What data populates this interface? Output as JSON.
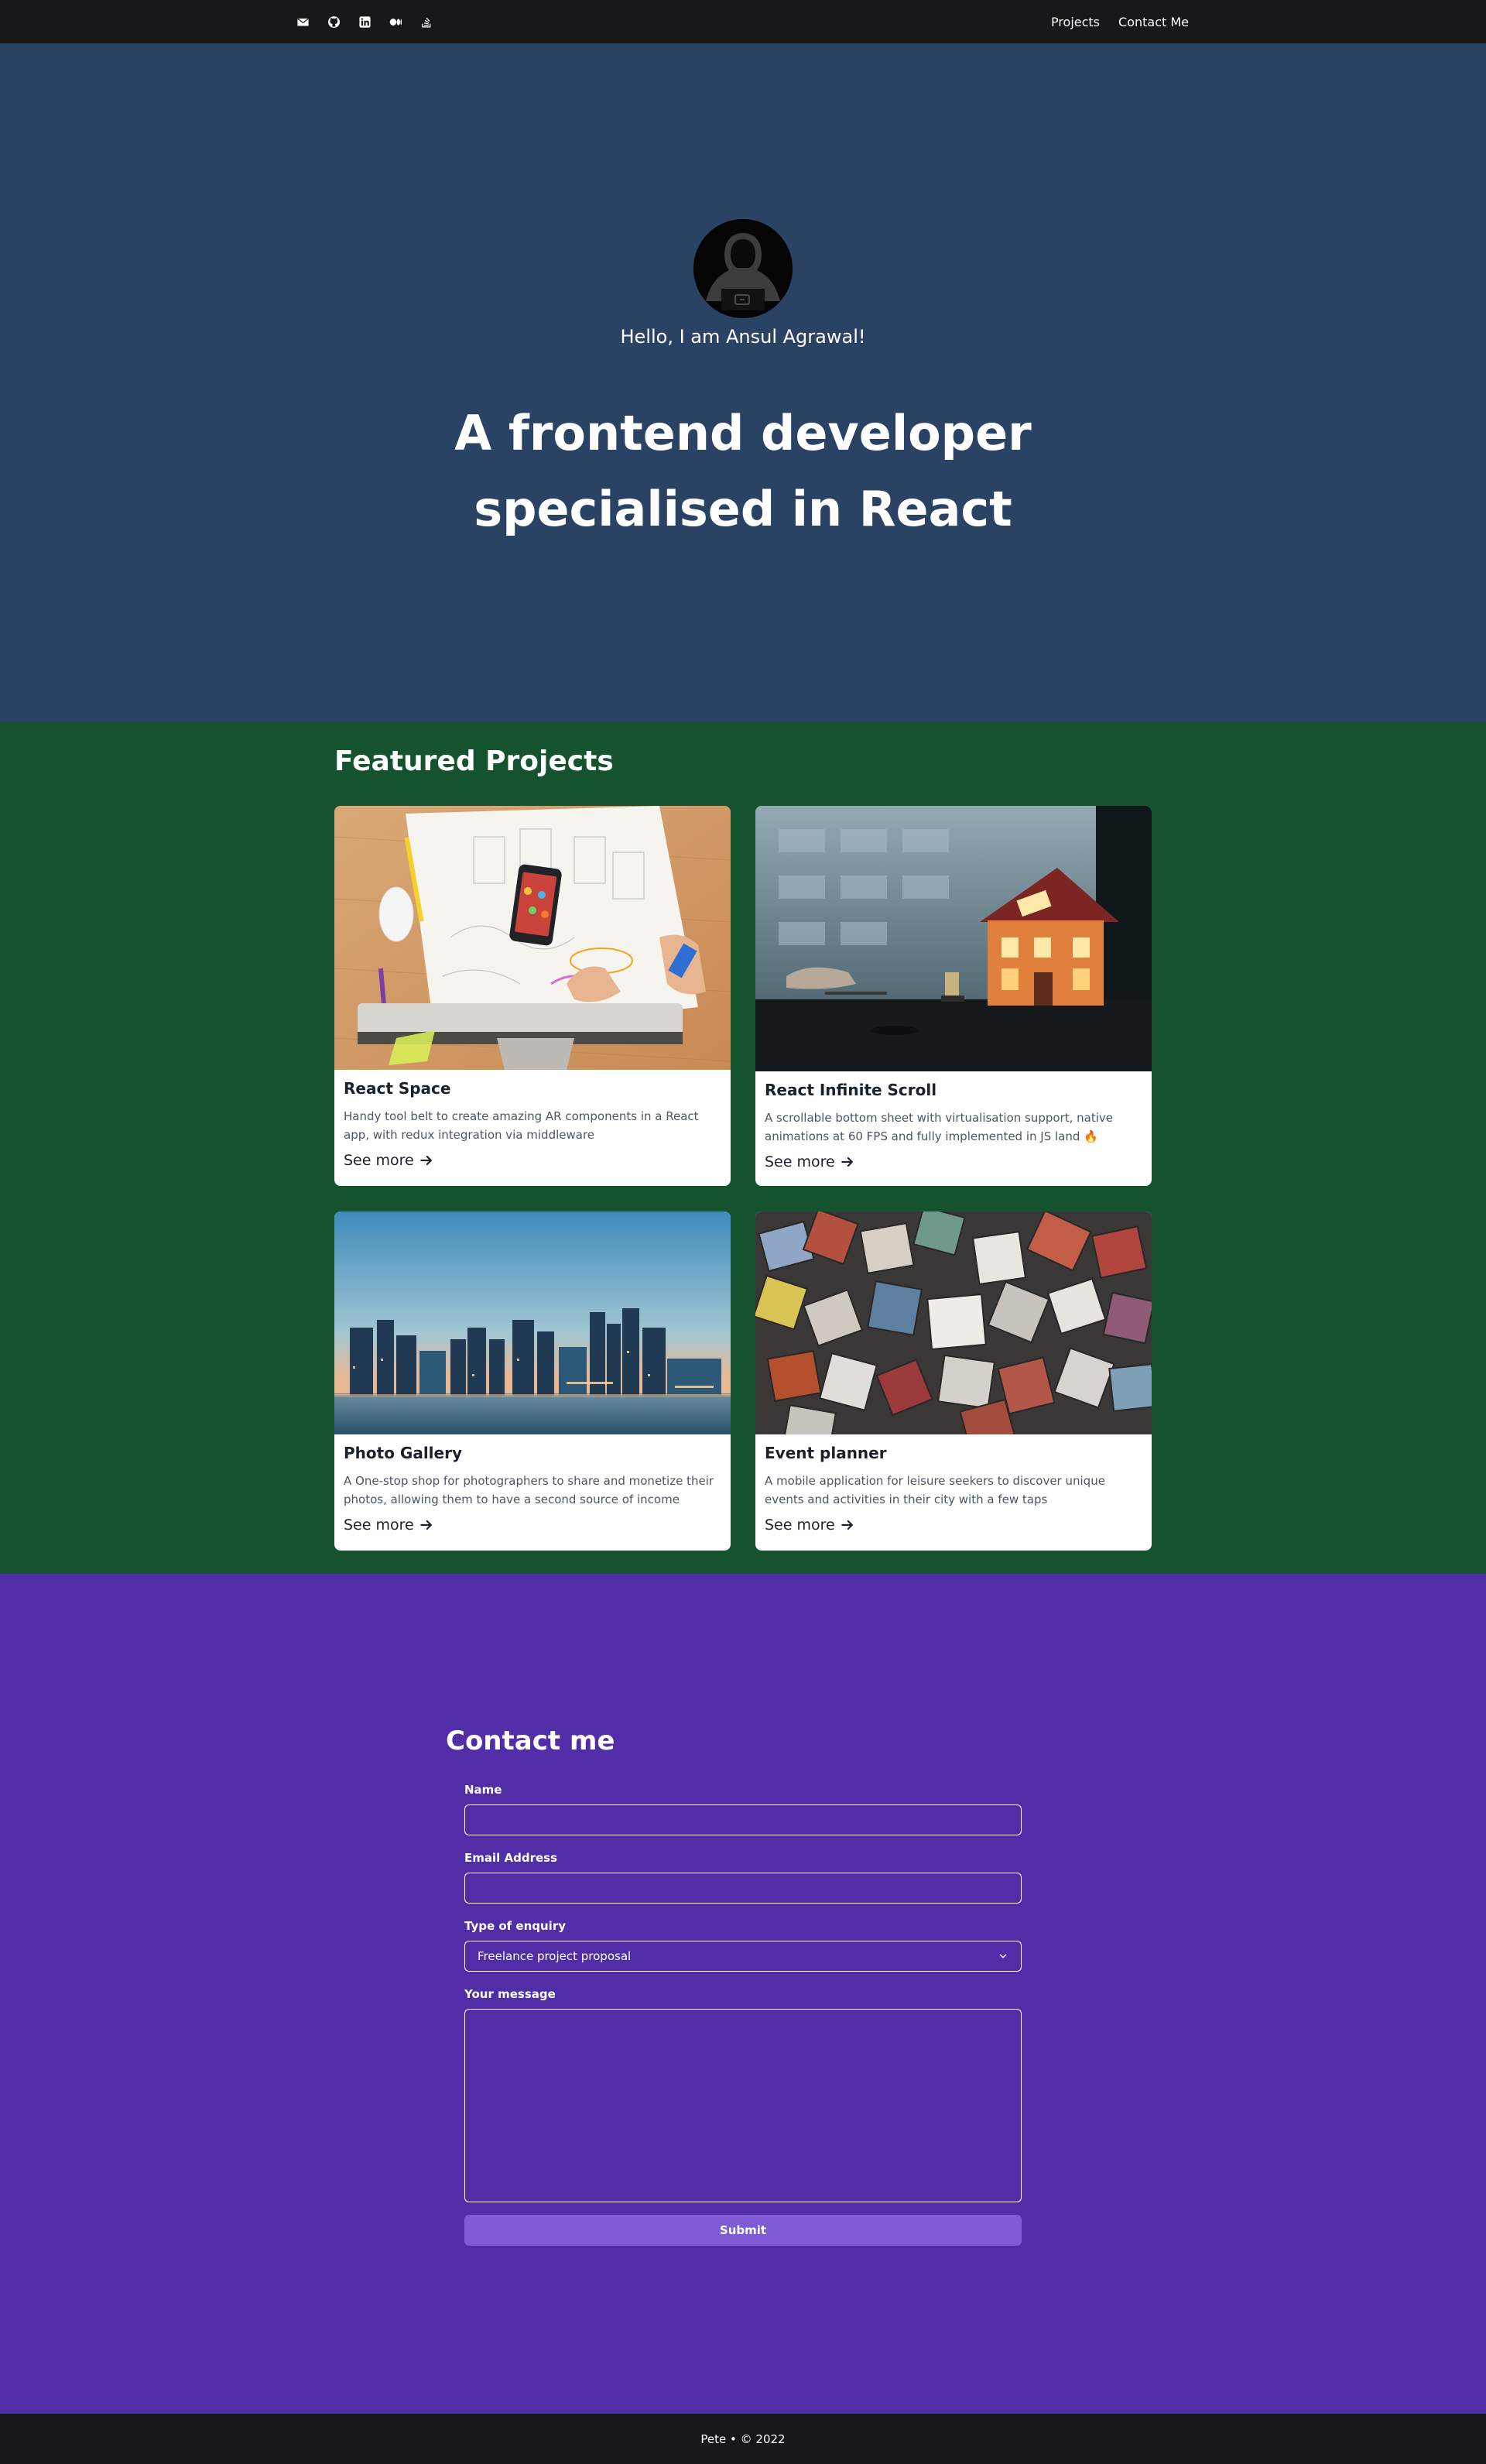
{
  "nav": {
    "icons": [
      "envelope-icon",
      "github-icon",
      "linkedin-icon",
      "medium-icon",
      "stack-overflow-icon"
    ],
    "links": [
      "Projects",
      "Contact Me"
    ]
  },
  "hero": {
    "greeting": "Hello, I am Ansul Agrawal!",
    "title_line1": "A frontend developer",
    "title_line2": "specialised in React",
    "background": "#2a4365"
  },
  "projects": {
    "heading": "Featured Projects",
    "background": "#14532d",
    "items": [
      {
        "title": "React Space",
        "description": "Handy tool belt to create amazing AR components in a React app, with redux integration via middleware",
        "link": "See more"
      },
      {
        "title": "React Infinite Scroll",
        "description": "A scrollable bottom sheet with virtualisation support, native animations at 60 FPS and fully implemented in JS land 🔥",
        "link": "See more"
      },
      {
        "title": "Photo Gallery",
        "description": "A One-stop shop for photographers to share and monetize their photos, allowing them to have a second source of income",
        "link": "See more"
      },
      {
        "title": "Event planner",
        "description": "A mobile application for leisure seekers to discover unique events and activities in their city with a few taps",
        "link": "See more"
      }
    ]
  },
  "contact": {
    "heading": "Contact me",
    "background": "#512da8",
    "name_label": "Name",
    "name_value": "",
    "email_label": "Email Address",
    "email_value": "",
    "enquiry_label": "Type of enquiry",
    "enquiry_value": "Freelance project proposal",
    "message_label": "Your message",
    "message_value": "",
    "submit_label": "Submit",
    "submit_color": "#805ad5"
  },
  "footer": {
    "text": "Pete • © 2022"
  }
}
